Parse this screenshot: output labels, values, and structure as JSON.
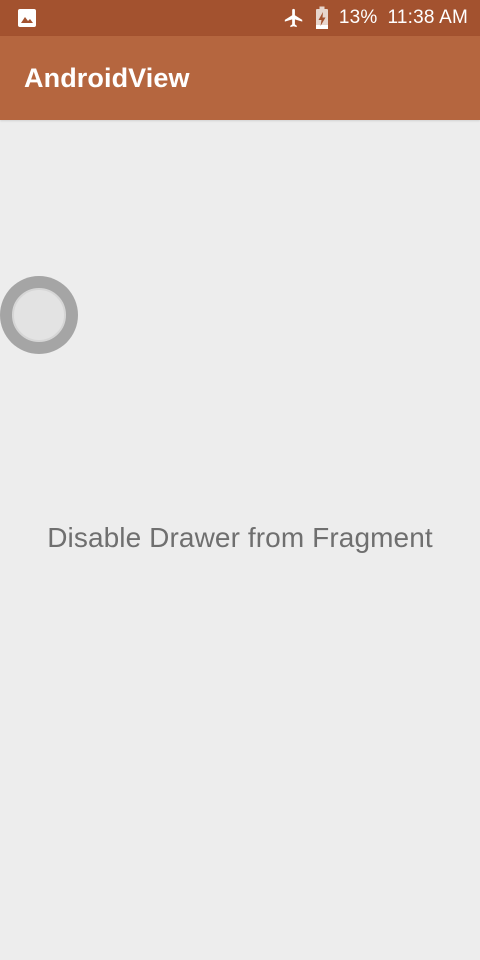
{
  "status_bar": {
    "left_icon": "image-notification-icon",
    "airplane_icon": "airplane-icon",
    "battery_icon": "battery-charging-icon",
    "battery_level": "13%",
    "time": "11:38 AM"
  },
  "toolbar": {
    "title": "AndroidView"
  },
  "content": {
    "drawer_handle_icon": "drawer-handle-icon",
    "message": "Disable Drawer from Fragment"
  },
  "colors": {
    "status_bar": "#a3522f",
    "toolbar": "#b5663f",
    "background": "#ededed",
    "text": "#6f6f6f"
  }
}
